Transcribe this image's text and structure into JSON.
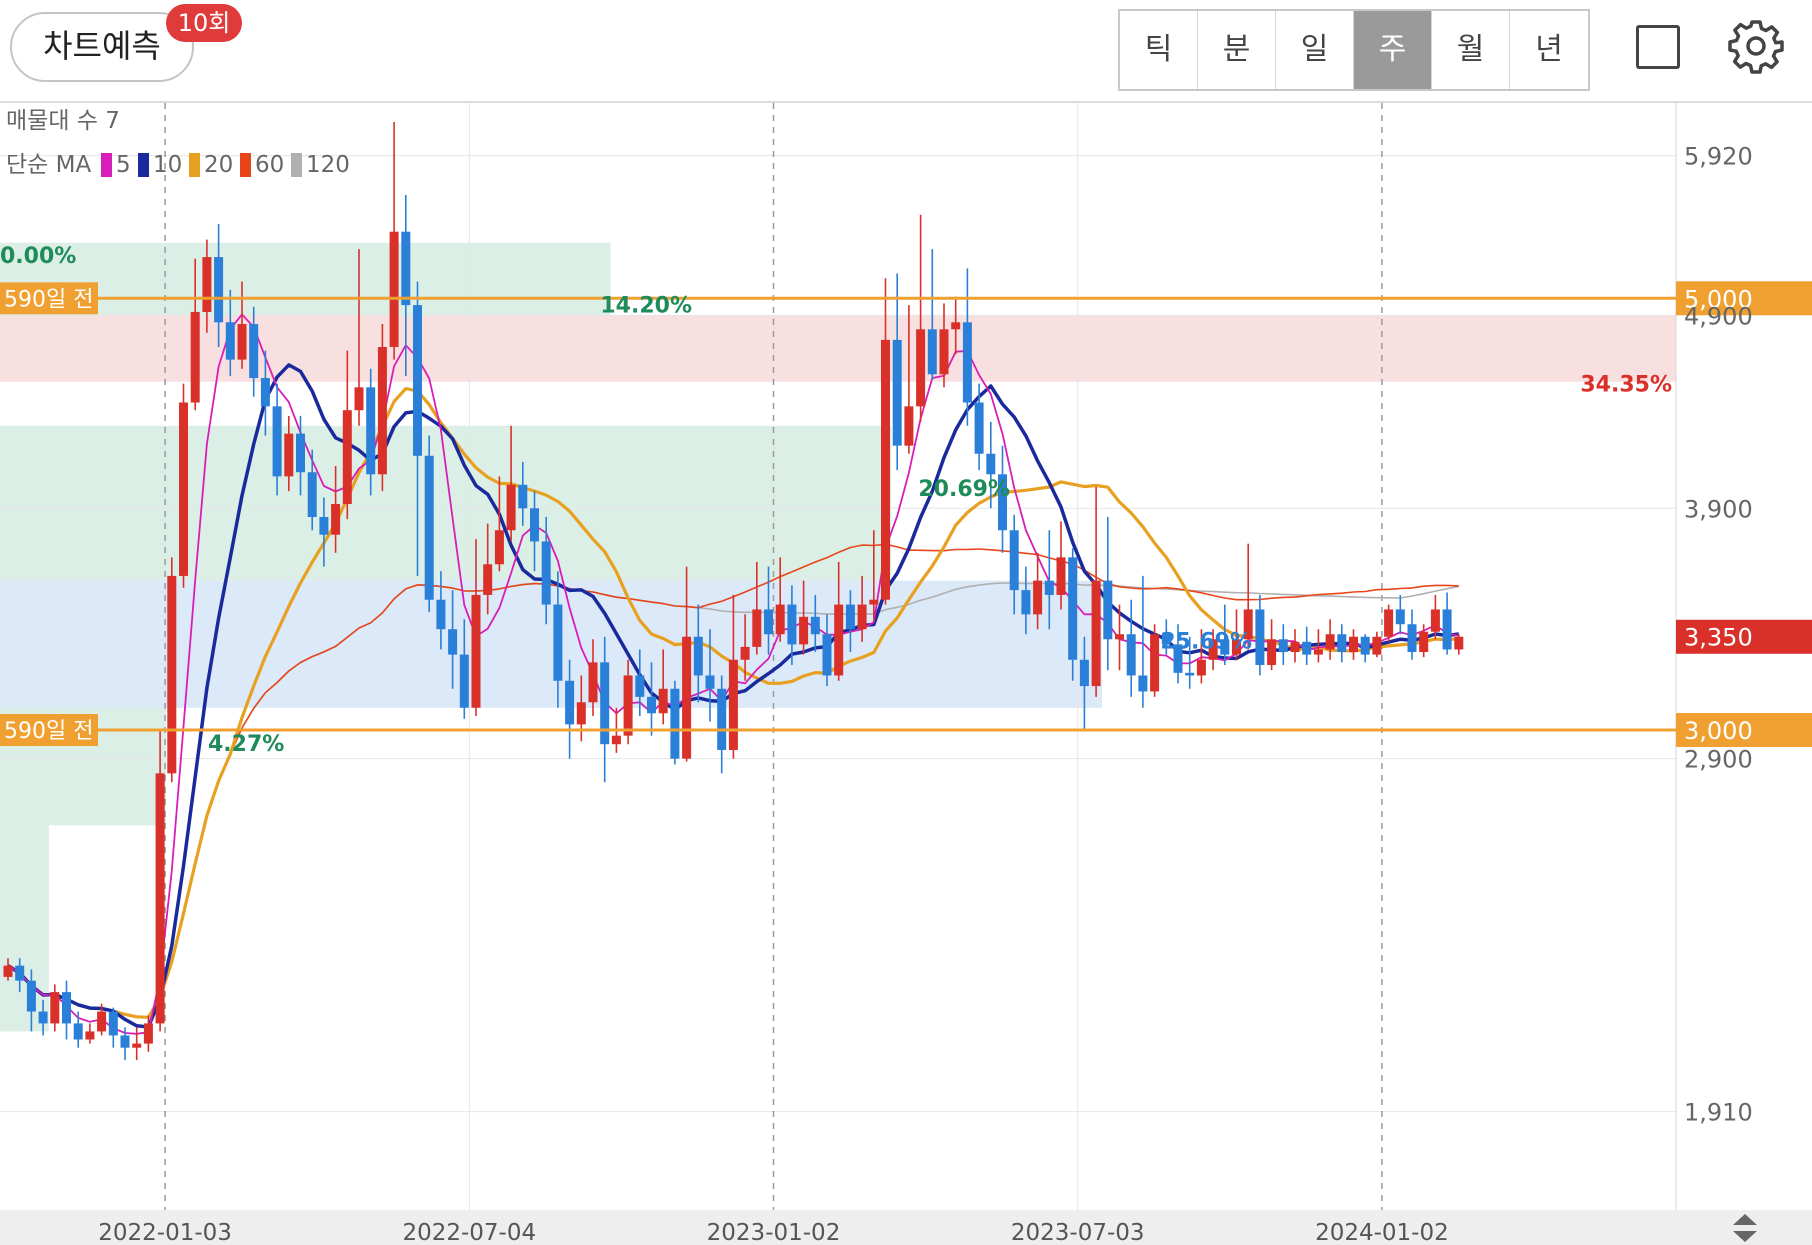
{
  "header": {
    "predict_label": "차트예측",
    "predict_count": "10회",
    "tabs": [
      "틱",
      "분",
      "일",
      "주",
      "월",
      "년"
    ],
    "active_tab": "주"
  },
  "indicators": {
    "volume_profile": "매물대 수 7",
    "ma_prefix": "단순 MA",
    "ma": [
      {
        "period": "5",
        "color": "#d81eb8"
      },
      {
        "period": "10",
        "color": "#1a2a9c"
      },
      {
        "period": "20",
        "color": "#e8a020"
      },
      {
        "period": "60",
        "color": "#e8461a"
      },
      {
        "period": "120",
        "color": "#b0b0b0"
      }
    ]
  },
  "colors": {
    "up": "#d9302a",
    "down": "#2a7fd8",
    "level": "#f0a030",
    "green_zone": "#dcefe6",
    "red_zone": "#f8e0e0",
    "blue_zone": "#dce9f8"
  },
  "chart_data": {
    "type": "candlestick",
    "x_ticks": [
      "2022-01-03",
      "2022-07-04",
      "2023-01-02",
      "2023-07-03",
      "2024-01-02"
    ],
    "y_ticks": [
      5920,
      4900,
      3900,
      2900,
      1910
    ],
    "ylim": [
      1700,
      6300
    ],
    "levels": [
      {
        "price": 5000,
        "price_label": "5,000",
        "side_label": "590일 전"
      },
      {
        "price": 3000,
        "price_label": "3,000",
        "side_label": "590일 전"
      }
    ],
    "current_price": {
      "price": 3350,
      "label": "3,350"
    },
    "zones": [
      {
        "label": "0.00%",
        "color": "green",
        "from": 2100,
        "to": 2680,
        "x0": 0,
        "x1": 3
      },
      {
        "label": "4.27%",
        "color": "green",
        "from": 2680,
        "to": 3120,
        "x0": 0,
        "x1": 13
      },
      {
        "label": "14.20%",
        "color": "green",
        "from": 4900,
        "to": 5340,
        "x0": 0,
        "x1": 51
      },
      {
        "label": "34.35%",
        "color": "red",
        "from": 4530,
        "to": 4900,
        "x0": 0,
        "x1": 124
      },
      {
        "label": "20.69%",
        "color": "green",
        "from": 3580,
        "to": 4300,
        "x0": 0,
        "x1": 75
      },
      {
        "label": "25.69%",
        "color": "blue",
        "from": 3080,
        "to": 3580,
        "x0": 0,
        "x1": 93
      }
    ],
    "candles": [
      [
        2240,
        2270,
        2230,
        2290
      ],
      [
        2270,
        2230,
        2200,
        2290
      ],
      [
        2230,
        2150,
        2100,
        2260
      ],
      [
        2150,
        2120,
        2090,
        2180
      ],
      [
        2120,
        2200,
        2100,
        2220
      ],
      [
        2200,
        2120,
        2080,
        2230
      ],
      [
        2120,
        2080,
        2060,
        2150
      ],
      [
        2080,
        2100,
        2070,
        2120
      ],
      [
        2100,
        2150,
        2090,
        2170
      ],
      [
        2150,
        2090,
        2060,
        2160
      ],
      [
        2090,
        2060,
        2030,
        2110
      ],
      [
        2060,
        2070,
        2030,
        2110
      ],
      [
        2070,
        2120,
        2050,
        2140
      ],
      [
        2120,
        2850,
        2100,
        3000
      ],
      [
        2850,
        3600,
        2820,
        3680
      ],
      [
        3600,
        4420,
        3550,
        4520
      ],
      [
        4420,
        4920,
        4380,
        5240
      ],
      [
        4920,
        5250,
        4800,
        5360
      ],
      [
        5250,
        4860,
        4720,
        5460
      ],
      [
        4860,
        4650,
        4560,
        5050
      ],
      [
        4650,
        4850,
        4600,
        5100
      ],
      [
        4850,
        4550,
        4450,
        4950
      ],
      [
        4550,
        4400,
        4250,
        4700
      ],
      [
        4400,
        4050,
        3960,
        4520
      ],
      [
        4050,
        4260,
        3980,
        4350
      ],
      [
        4260,
        4070,
        3960,
        4350
      ],
      [
        4070,
        3860,
        3800,
        4180
      ],
      [
        3860,
        3780,
        3640,
        3950
      ],
      [
        3780,
        3920,
        3700,
        4100
      ],
      [
        3920,
        4380,
        3850,
        4700
      ],
      [
        4380,
        4500,
        4300,
        5300
      ],
      [
        4500,
        4060,
        3960,
        4600
      ],
      [
        4060,
        4720,
        3980,
        4850
      ],
      [
        4720,
        5410,
        4650,
        6160
      ],
      [
        5410,
        4960,
        4560,
        5650
      ],
      [
        4960,
        4150,
        3600,
        5100
      ],
      [
        4150,
        3500,
        3450,
        4250
      ],
      [
        3500,
        3380,
        3300,
        3620
      ],
      [
        3380,
        3280,
        3150,
        3540
      ],
      [
        3280,
        3080,
        3040,
        3420
      ],
      [
        3080,
        3520,
        3050,
        3760
      ],
      [
        3520,
        3650,
        3440,
        3830
      ],
      [
        3650,
        3800,
        3620,
        4050
      ],
      [
        3800,
        4010,
        3750,
        4300
      ],
      [
        4010,
        3900,
        3820,
        4120
      ],
      [
        3900,
        3750,
        3620,
        3980
      ],
      [
        3750,
        3480,
        3400,
        3860
      ],
      [
        3480,
        3180,
        3080,
        3620
      ],
      [
        3180,
        3020,
        2900,
        3260
      ],
      [
        3020,
        3100,
        2960,
        3200
      ],
      [
        3100,
        3250,
        3050,
        3340
      ],
      [
        3250,
        2950,
        2820,
        3350
      ],
      [
        2950,
        2980,
        2920,
        3080
      ],
      [
        2980,
        3200,
        2950,
        3260
      ],
      [
        3200,
        3120,
        3050,
        3300
      ],
      [
        3120,
        3060,
        2980,
        3250
      ],
      [
        3060,
        3150,
        3020,
        3300
      ],
      [
        3150,
        2900,
        2880,
        3180
      ],
      [
        2900,
        3350,
        2890,
        3640
      ],
      [
        3350,
        3200,
        3100,
        3480
      ],
      [
        3200,
        3150,
        3030,
        3380
      ],
      [
        3150,
        2930,
        2850,
        3200
      ],
      [
        2930,
        3260,
        2900,
        3520
      ],
      [
        3260,
        3310,
        3180,
        3440
      ],
      [
        3310,
        3460,
        3280,
        3660
      ],
      [
        3460,
        3360,
        3280,
        3640
      ],
      [
        3360,
        3480,
        3330,
        3680
      ],
      [
        3480,
        3320,
        3240,
        3560
      ],
      [
        3320,
        3430,
        3280,
        3580
      ],
      [
        3430,
        3360,
        3290,
        3520
      ],
      [
        3360,
        3200,
        3160,
        3440
      ],
      [
        3200,
        3480,
        3180,
        3660
      ],
      [
        3480,
        3380,
        3290,
        3540
      ],
      [
        3380,
        3480,
        3330,
        3600
      ],
      [
        3480,
        3500,
        3410,
        3800
      ],
      [
        3500,
        4760,
        3480,
        5120
      ],
      [
        4760,
        4200,
        4080,
        5150
      ],
      [
        4200,
        4400,
        4160,
        4960
      ],
      [
        4400,
        4820,
        4320,
        5520
      ],
      [
        4820,
        4570,
        4540,
        5300
      ],
      [
        4570,
        4820,
        4500,
        4970
      ],
      [
        4820,
        4860,
        4680,
        5010
      ],
      [
        4860,
        4420,
        4300,
        5180
      ],
      [
        4420,
        4160,
        4080,
        4520
      ],
      [
        4160,
        4060,
        3900,
        4320
      ],
      [
        4060,
        3800,
        3700,
        4200
      ],
      [
        3800,
        3540,
        3440,
        3870
      ],
      [
        3540,
        3440,
        3360,
        3640
      ],
      [
        3440,
        3580,
        3380,
        3700
      ],
      [
        3580,
        3520,
        3380,
        3800
      ],
      [
        3520,
        3680,
        3460,
        3840
      ],
      [
        3680,
        3260,
        3180,
        3720
      ],
      [
        3260,
        3160,
        3000,
        3350
      ],
      [
        3160,
        3580,
        3120,
        4000
      ],
      [
        3580,
        3340,
        3220,
        3860
      ],
      [
        3340,
        3360,
        3220,
        3480
      ],
      [
        3360,
        3200,
        3120,
        3500
      ],
      [
        3200,
        3140,
        3080,
        3600
      ],
      [
        3140,
        3360,
        3120,
        3400
      ],
      [
        3360,
        3320,
        3280,
        3420
      ],
      [
        3320,
        3210,
        3170,
        3400
      ],
      [
        3210,
        3200,
        3150,
        3350
      ],
      [
        3200,
        3260,
        3170,
        3380
      ],
      [
        3260,
        3340,
        3220,
        3380
      ],
      [
        3340,
        3280,
        3240,
        3480
      ],
      [
        3280,
        3340,
        3260,
        3460
      ],
      [
        3340,
        3460,
        3300,
        3740
      ],
      [
        3460,
        3240,
        3200,
        3520
      ],
      [
        3240,
        3340,
        3220,
        3420
      ],
      [
        3340,
        3290,
        3240,
        3400
      ],
      [
        3290,
        3330,
        3250,
        3380
      ],
      [
        3330,
        3280,
        3240,
        3390
      ],
      [
        3280,
        3300,
        3250,
        3380
      ],
      [
        3300,
        3360,
        3260,
        3420
      ],
      [
        3360,
        3290,
        3250,
        3400
      ],
      [
        3290,
        3350,
        3260,
        3380
      ],
      [
        3350,
        3280,
        3250,
        3360
      ],
      [
        3280,
        3350,
        3270,
        3370
      ],
      [
        3350,
        3460,
        3330,
        3480
      ],
      [
        3460,
        3400,
        3360,
        3520
      ],
      [
        3400,
        3290,
        3260,
        3460
      ],
      [
        3290,
        3370,
        3270,
        3400
      ],
      [
        3370,
        3460,
        3340,
        3520
      ],
      [
        3460,
        3300,
        3280,
        3530
      ],
      [
        3300,
        3350,
        3280,
        3360
      ]
    ]
  }
}
